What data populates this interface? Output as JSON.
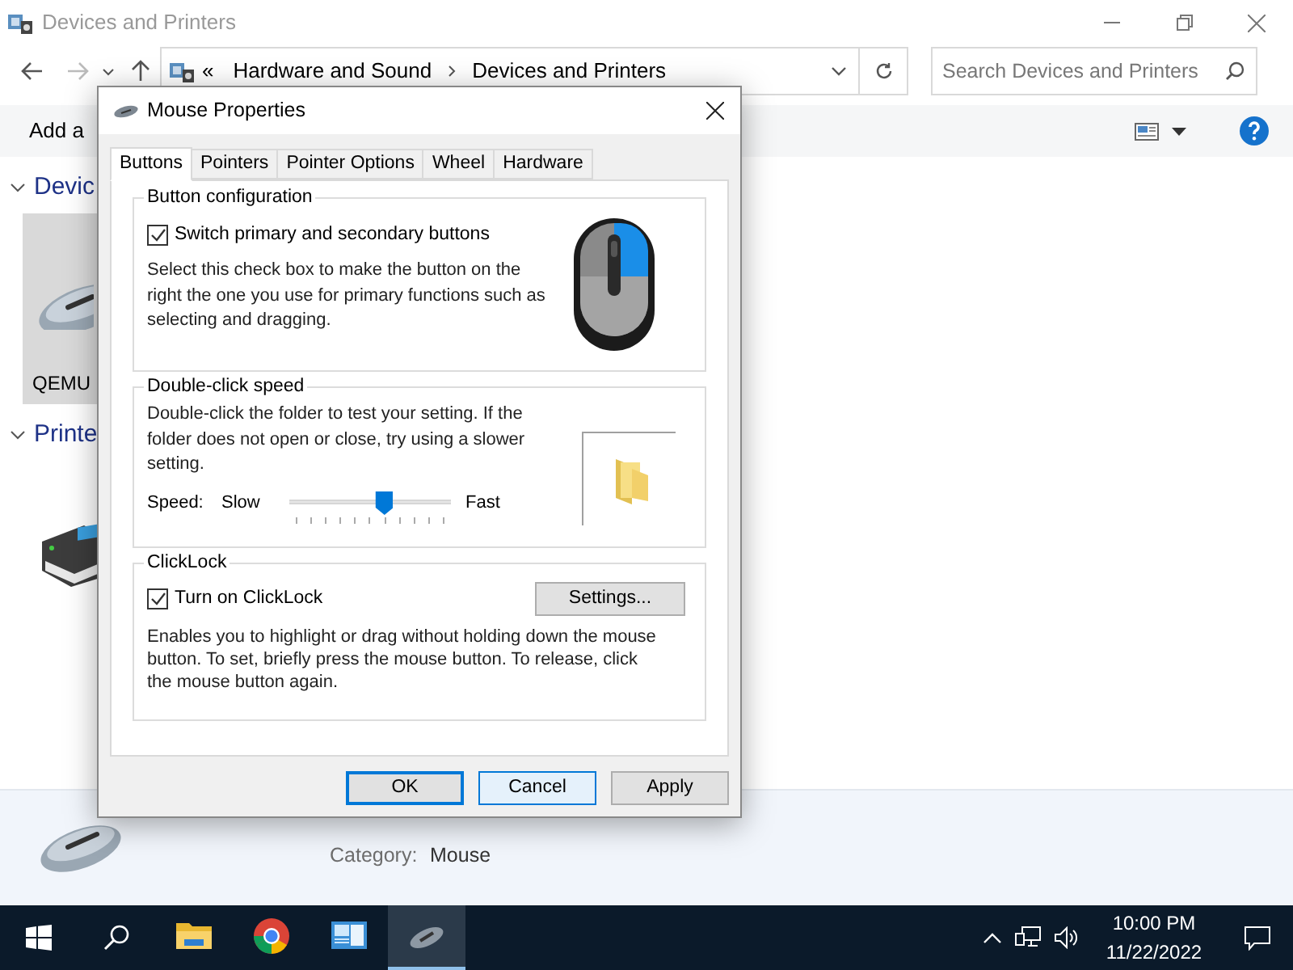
{
  "window": {
    "title": "Devices and Printers"
  },
  "address_bar": {
    "overflow": "«",
    "breadcrumbs": [
      "Hardware and Sound",
      "Devices and Printers"
    ]
  },
  "search": {
    "placeholder": "Search Devices and Printers"
  },
  "command_bar": {
    "items": [
      "Add a"
    ]
  },
  "groups": [
    {
      "title": "Devic",
      "expanded": true,
      "devices": [
        {
          "kind": "mouse",
          "label": "QEMU",
          "selected": true
        }
      ]
    },
    {
      "title": "Printe",
      "expanded": true,
      "devices": [
        {
          "kind": "printer",
          "selected": false
        }
      ]
    }
  ],
  "details_pane": {
    "kind": "mouse",
    "fields": [
      {
        "label": "Category:",
        "value": "Mouse"
      }
    ]
  },
  "dialog": {
    "title": "Mouse Properties",
    "tabs": [
      {
        "label": "Buttons",
        "selected": true
      },
      {
        "label": "Pointers",
        "selected": false
      },
      {
        "label": "Pointer Options",
        "selected": false
      },
      {
        "label": "Wheel",
        "selected": false
      },
      {
        "label": "Hardware",
        "selected": false
      }
    ],
    "button_configuration": {
      "title": "Button configuration",
      "checkbox": {
        "label": "Switch primary and secondary buttons",
        "checked": true
      },
      "description": "Select this check box to make the button on the right the one you use for primary functions such as selecting and dragging."
    },
    "double_click_speed": {
      "title": "Double-click speed",
      "description": "Double-click the folder to test your setting. If the folder does not open or close, try using a slower setting.",
      "speed_label": "Speed:",
      "slow": "Slow",
      "fast": "Fast",
      "level": 0.6
    },
    "clicklock": {
      "title": "ClickLock",
      "checkbox": {
        "label": "Turn on ClickLock",
        "checked": true
      },
      "settings_button": "Settings...",
      "description": "Enables you to highlight or drag without holding down the mouse button. To set, briefly press the mouse button. To release, click the mouse button again."
    },
    "buttons": [
      {
        "label": "OK",
        "default": true,
        "hovered": false
      },
      {
        "label": "Cancel",
        "default": false,
        "hovered": true
      },
      {
        "label": "Apply",
        "default": false,
        "hovered": false
      }
    ]
  },
  "taskbar": {
    "apps": [
      {
        "kind": "folder",
        "active": false
      },
      {
        "kind": "browser",
        "active": false
      },
      {
        "kind": "control-panel",
        "active": false
      },
      {
        "kind": "mouse",
        "active": true
      }
    ],
    "clock": {
      "time": "10:00 PM",
      "date": "11/22/2022"
    }
  }
}
